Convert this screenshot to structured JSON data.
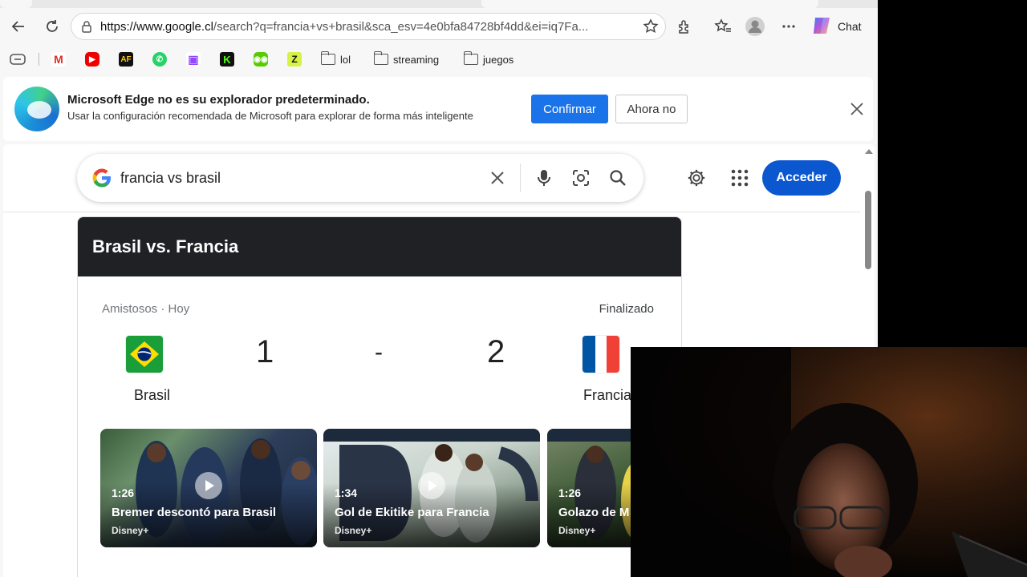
{
  "browser": {
    "url_prefix": "https://www.google.cl",
    "url_rest": "/search?q=francia+vs+brasil&sca_esv=4e0bfa84728bf4dd&ei=iq7Fa...",
    "chat_label": "Chat",
    "bookmarks": [
      {
        "label": "lol"
      },
      {
        "label": "streaming"
      },
      {
        "label": "juegos"
      }
    ]
  },
  "infobar": {
    "title": "Microsoft Edge no es su explorador predeterminado.",
    "subtitle": "Usar la configuración recomendada de Microsoft para explorar de forma más inteligente",
    "confirm_label": "Confirmar",
    "later_label": "Ahora no"
  },
  "search": {
    "query": "francia vs brasil",
    "signin_label": "Acceder"
  },
  "match": {
    "header": "Brasil vs. Francia",
    "league": "Amistosos · Hoy",
    "status": "Finalizado",
    "home_team": "Brasil",
    "away_team": "Francia",
    "home_score": "1",
    "separator": "-",
    "away_score": "2",
    "videos": [
      {
        "duration": "1:26",
        "title": "Bremer descontó para Brasil",
        "source": "Disney+"
      },
      {
        "duration": "1:34",
        "title": "Gol de Ekitike para Francia",
        "source": "Disney+"
      },
      {
        "duration": "1:26",
        "title": "Golazo de M",
        "source": "Disney+"
      }
    ]
  },
  "colors": {
    "accent_blue": "#1a73e8",
    "signin_blue": "#0b57d0",
    "match_header_bg": "#202124"
  }
}
